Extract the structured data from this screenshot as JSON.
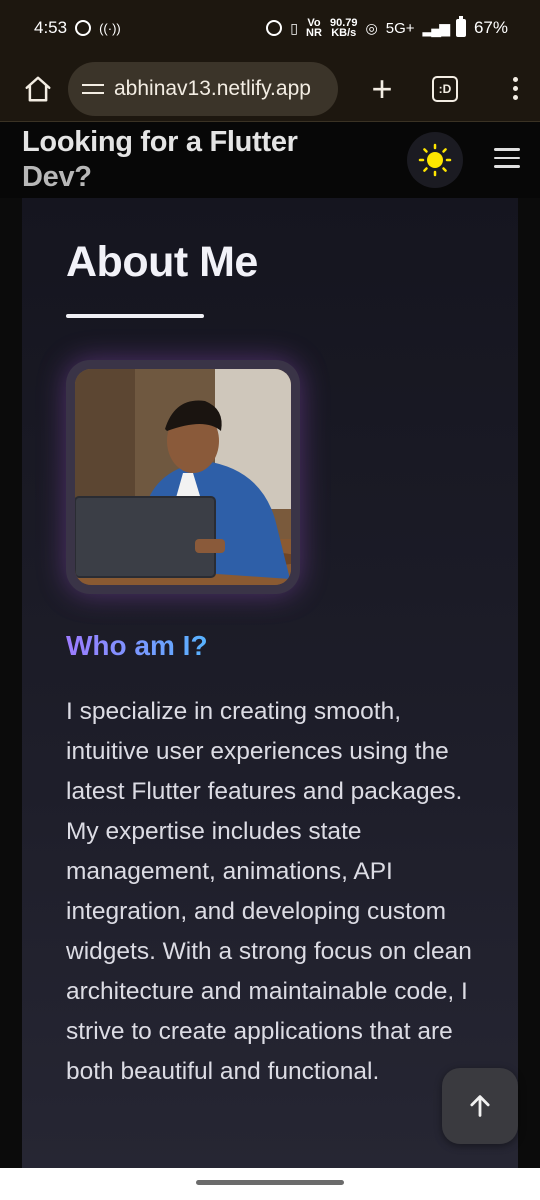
{
  "status_bar": {
    "time": "4:53",
    "network_speed_value": "90.79",
    "network_speed_unit": "KB/s",
    "volte": "Vo NR",
    "network_type": "5G+",
    "battery": "67%"
  },
  "browser": {
    "url": "abhinav13.netlify.app",
    "tabs_label": ":D"
  },
  "header": {
    "title_part1": "Looking for a Flutter",
    "title_part2": "Dev?"
  },
  "about": {
    "heading": "About Me",
    "who_heading": "Who am I?",
    "bio": "I specialize in creating smooth, intuitive user experiences using the latest Flutter features and packages. My expertise includes state management, animations, API integration, and developing custom widgets. With a strong focus on clean architecture and maintainable code, I strive to create applications that are both beautiful and functional."
  },
  "colors": {
    "accent_start": "#9d7bff",
    "accent_end": "#57b3ff",
    "sun": "#ffe600"
  }
}
